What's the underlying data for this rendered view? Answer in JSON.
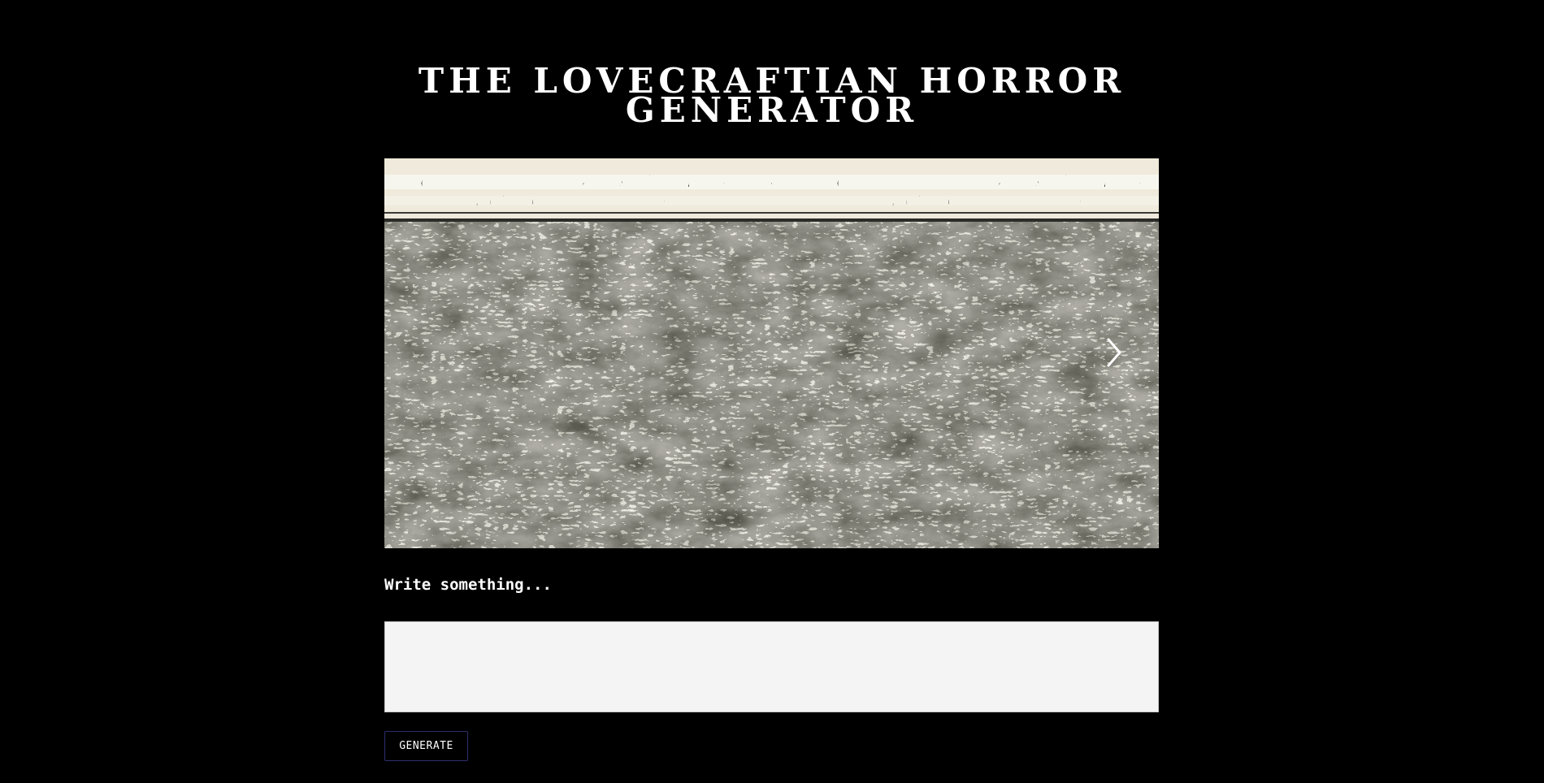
{
  "header": {
    "title_line1": "THE LOVECRAFTIAN HORROR",
    "title_line2": "GENERATOR"
  },
  "carousel": {
    "image_alt": "Engraved illustration of a rocky landscape",
    "next_icon": "chevron-right-icon"
  },
  "form": {
    "prompt_label": "Write something...",
    "prompt_value": "",
    "prompt_placeholder": "",
    "generate_label": "GENERATE"
  },
  "colors": {
    "background": "#000000",
    "text": "#ffffff",
    "input_background": "#f4f4f4",
    "button_border": "#2d2d6e"
  }
}
